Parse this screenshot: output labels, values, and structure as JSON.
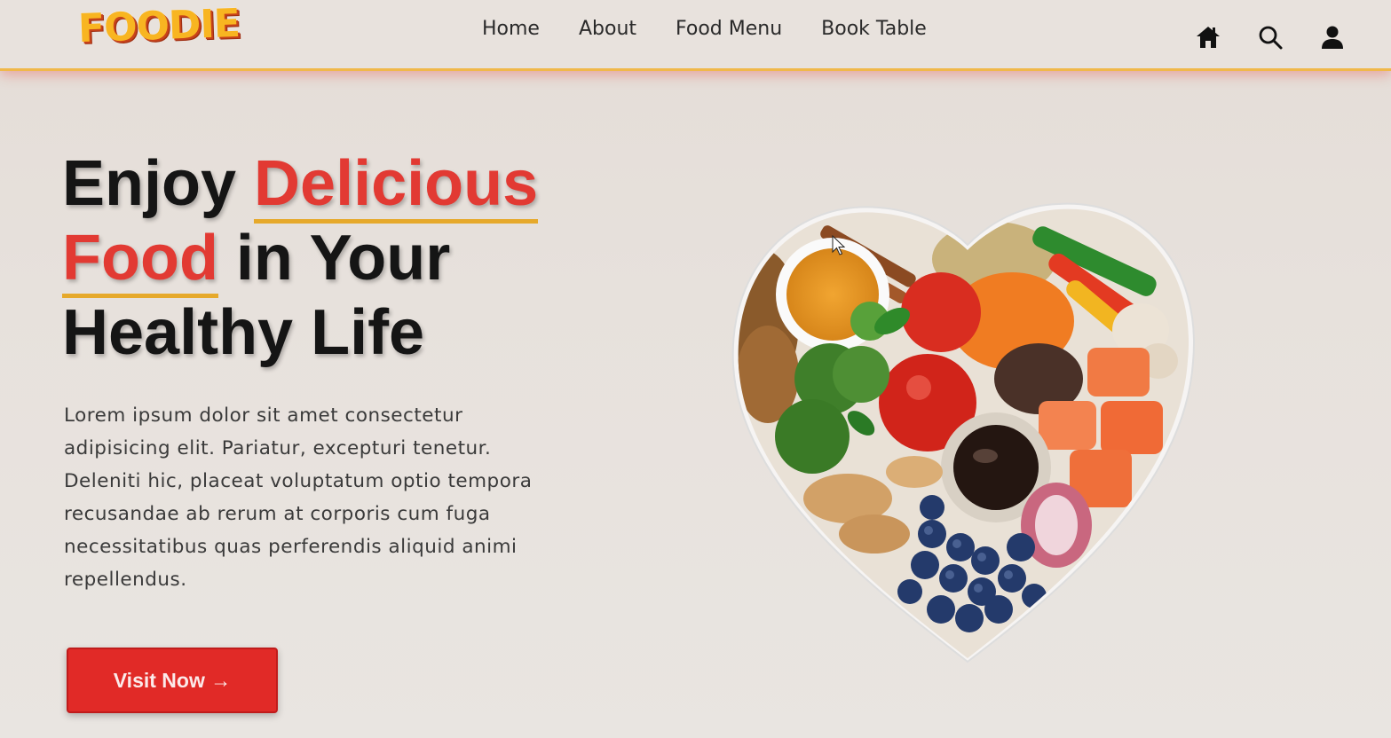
{
  "header": {
    "logo_text": "FOODIE",
    "nav": [
      {
        "label": "Home"
      },
      {
        "label": "About"
      },
      {
        "label": "Food Menu"
      },
      {
        "label": "Book Table"
      }
    ],
    "icons": [
      "home-icon",
      "search-icon",
      "user-icon"
    ]
  },
  "hero": {
    "title_part1": "Enjoy ",
    "title_highlight1": "Delicious",
    "title_highlight2": "Food",
    "title_part2": " in Your",
    "title_part3": "Healthy Life",
    "description": "Lorem ipsum dolor sit amet consectetur adipisicing elit. Pariatur, excepturi tenetur. Deleniti hic, placeat voluptatum optio tempora recusandae ab rerum at corporis cum fuga necessitatibus quas perferendis aliquid animi repellendus.",
    "button_label": "Visit Now →"
  },
  "colors": {
    "accent": "#e23a33",
    "underline": "#e6a92b",
    "button": "#e12a27"
  }
}
